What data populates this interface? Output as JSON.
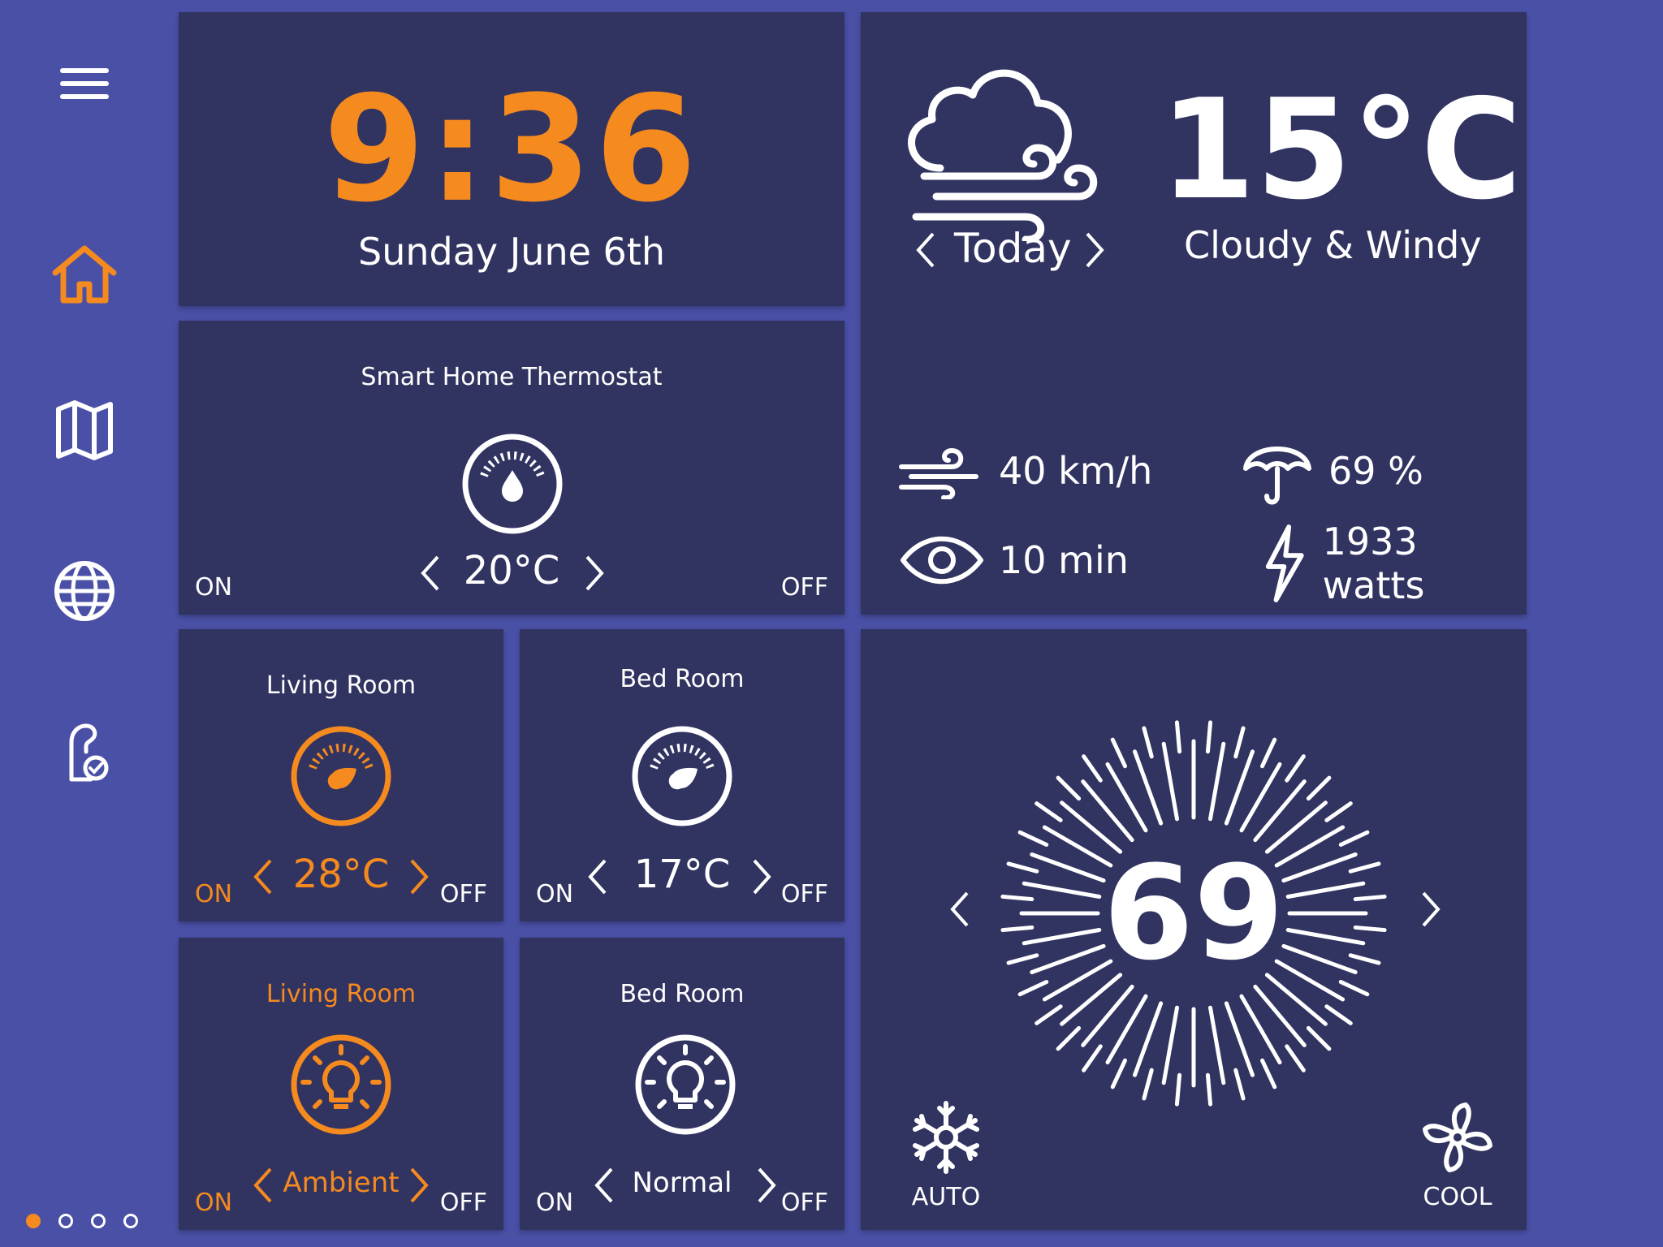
{
  "colors": {
    "background": "#4a50a6",
    "card": "#313361",
    "accent": "#f58a1f",
    "text": "#ffffff"
  },
  "sidebar": {
    "items": [
      {
        "icon": "menu-icon",
        "active": false
      },
      {
        "icon": "home-icon",
        "active": true
      },
      {
        "icon": "map-icon",
        "active": false
      },
      {
        "icon": "globe-icon",
        "active": false
      },
      {
        "icon": "door-hanger-icon",
        "active": false
      }
    ]
  },
  "pagination": {
    "count": 4,
    "active_index": 0
  },
  "clock": {
    "time": "9:36",
    "date": "Sunday June 6th"
  },
  "weather": {
    "temperature": "15°C",
    "day": "Today",
    "condition": "Cloudy & Windy",
    "wind": "40 km/h",
    "humidity": "69 %",
    "visibility": "10 min",
    "power": "1933 watts",
    "icons": [
      "cloud-wind-icon",
      "wind-icon",
      "umbrella-icon",
      "eye-icon",
      "lightning-icon"
    ]
  },
  "thermostat_main": {
    "title": "Smart Home Thermostat",
    "value": "20°C",
    "on": "ON",
    "off": "OFF"
  },
  "living_temp": {
    "title": "Living Room",
    "value": "28°C",
    "on": "ON",
    "off": "OFF"
  },
  "bed_temp": {
    "title": "Bed Room",
    "value": "17°C",
    "on": "ON",
    "off": "OFF"
  },
  "living_light": {
    "title": "Living Room",
    "value": "Ambient",
    "on": "ON",
    "off": "OFF"
  },
  "bed_light": {
    "title": "Bed Room",
    "value": "Normal",
    "on": "ON",
    "off": "OFF"
  },
  "climate": {
    "value": "69",
    "auto_label": "AUTO",
    "cool_label": "COOL"
  }
}
